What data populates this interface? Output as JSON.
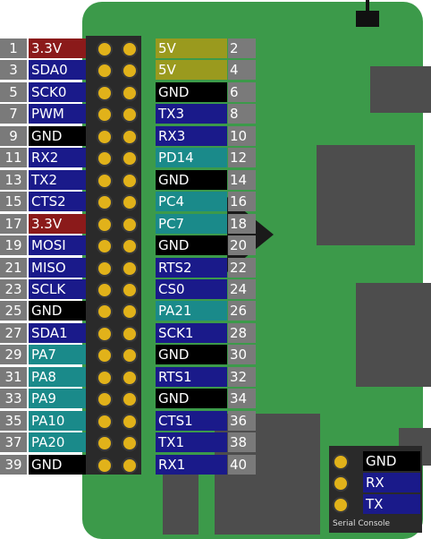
{
  "colors": {
    "board": "#3c9a4a",
    "power3v3": "#8b1a1a",
    "power5v": "#9a9a1e",
    "ground": "#000000",
    "gpio_blue": "#1a1a8a",
    "teal": "#1a8a8a",
    "pin_gold": "#e1b21a",
    "number_gray": "#7a7a7a"
  },
  "pins": [
    {
      "left_num": "1",
      "left_label": "3.3V",
      "left_color": "#8b1a1a",
      "right_label": "5V",
      "right_color": "#9a9a1e",
      "right_num": "2"
    },
    {
      "left_num": "3",
      "left_label": "SDA0",
      "left_color": "#1a1a8a",
      "right_label": "5V",
      "right_color": "#9a9a1e",
      "right_num": "4"
    },
    {
      "left_num": "5",
      "left_label": "SCK0",
      "left_color": "#1a1a8a",
      "right_label": "GND",
      "right_color": "#000000",
      "right_num": "6"
    },
    {
      "left_num": "7",
      "left_label": "PWM",
      "left_color": "#1a1a8a",
      "right_label": "TX3",
      "right_color": "#1a1a8a",
      "right_num": "8"
    },
    {
      "left_num": "9",
      "left_label": "GND",
      "left_color": "#000000",
      "right_label": "RX3",
      "right_color": "#1a1a8a",
      "right_num": "10"
    },
    {
      "left_num": "11",
      "left_label": "RX2",
      "left_color": "#1a1a8a",
      "right_label": "PD14",
      "right_color": "#1a8a8a",
      "right_num": "12"
    },
    {
      "left_num": "13",
      "left_label": "TX2",
      "left_color": "#1a1a8a",
      "right_label": "GND",
      "right_color": "#000000",
      "right_num": "14"
    },
    {
      "left_num": "15",
      "left_label": "CTS2",
      "left_color": "#1a1a8a",
      "right_label": "PC4",
      "right_color": "#1a8a8a",
      "right_num": "16"
    },
    {
      "left_num": "17",
      "left_label": "3.3V",
      "left_color": "#8b1a1a",
      "right_label": "PC7",
      "right_color": "#1a8a8a",
      "right_num": "18"
    },
    {
      "left_num": "19",
      "left_label": "MOSI",
      "left_color": "#1a1a8a",
      "right_label": "GND",
      "right_color": "#000000",
      "right_num": "20"
    },
    {
      "left_num": "21",
      "left_label": "MISO",
      "left_color": "#1a1a8a",
      "right_label": "RTS2",
      "right_color": "#1a1a8a",
      "right_num": "22"
    },
    {
      "left_num": "23",
      "left_label": "SCLK",
      "left_color": "#1a1a8a",
      "right_label": "CS0",
      "right_color": "#1a1a8a",
      "right_num": "24"
    },
    {
      "left_num": "25",
      "left_label": "GND",
      "left_color": "#000000",
      "right_label": "PA21",
      "right_color": "#1a8a8a",
      "right_num": "26"
    },
    {
      "left_num": "27",
      "left_label": "SDA1",
      "left_color": "#1a1a8a",
      "right_label": "SCK1",
      "right_color": "#1a1a8a",
      "right_num": "28"
    },
    {
      "left_num": "29",
      "left_label": "PA7",
      "left_color": "#1a8a8a",
      "right_label": "GND",
      "right_color": "#000000",
      "right_num": "30"
    },
    {
      "left_num": "31",
      "left_label": "PA8",
      "left_color": "#1a8a8a",
      "right_label": "RTS1",
      "right_color": "#1a1a8a",
      "right_num": "32"
    },
    {
      "left_num": "33",
      "left_label": "PA9",
      "left_color": "#1a8a8a",
      "right_label": "GND",
      "right_color": "#000000",
      "right_num": "34"
    },
    {
      "left_num": "35",
      "left_label": "PA10",
      "left_color": "#1a8a8a",
      "right_label": "CTS1",
      "right_color": "#1a1a8a",
      "right_num": "36"
    },
    {
      "left_num": "37",
      "left_label": "PA20",
      "left_color": "#1a8a8a",
      "right_label": "TX1",
      "right_color": "#1a1a8a",
      "right_num": "38"
    },
    {
      "left_num": "39",
      "left_label": "GND",
      "left_color": "#000000",
      "right_label": "RX1",
      "right_color": "#1a1a8a",
      "right_num": "40"
    }
  ],
  "serial_console": {
    "caption": "Serial Console",
    "rows": [
      {
        "label": "GND",
        "color": "#000000"
      },
      {
        "label": "RX",
        "color": "#1a1a8a"
      },
      {
        "label": "TX",
        "color": "#1a1a8a"
      }
    ]
  }
}
